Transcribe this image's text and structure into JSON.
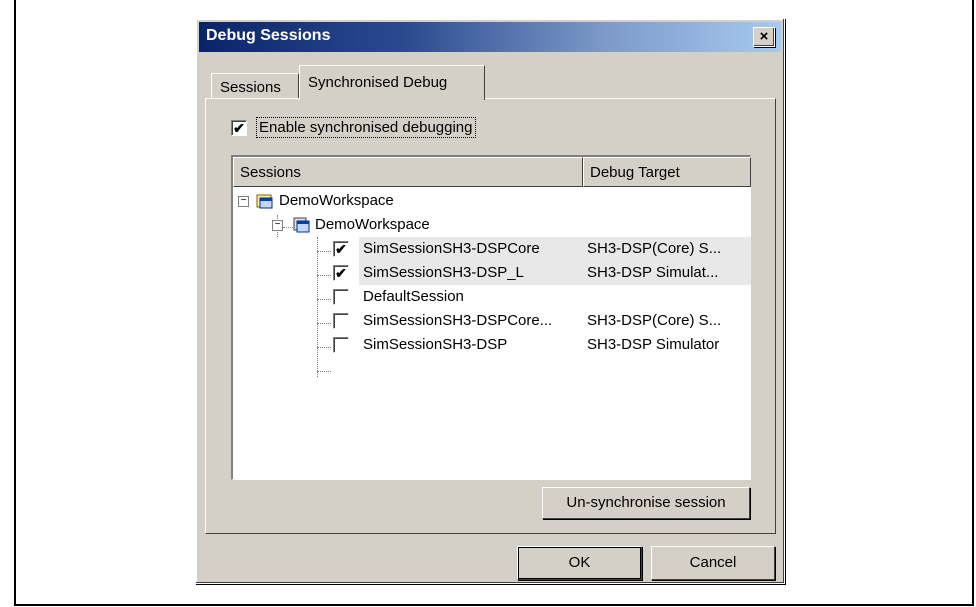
{
  "window": {
    "title": "Debug Sessions",
    "close_label": "×"
  },
  "tabs": [
    {
      "label": "Sessions",
      "active": false
    },
    {
      "label": "Synchronised Debug",
      "active": true
    }
  ],
  "enable_sync": {
    "label": "Enable synchronised debugging",
    "checked": true
  },
  "tree": {
    "columns": [
      "Sessions",
      "Debug Target"
    ],
    "workspace": "DemoWorkspace",
    "project": "DemoWorkspace",
    "sessions": [
      {
        "name": "SimSessionSH3-DSPCore",
        "target": "SH3-DSP(Core) S...",
        "checked": true,
        "highlighted": true
      },
      {
        "name": "SimSessionSH3-DSP_L",
        "target": "SH3-DSP Simulat...",
        "checked": true,
        "highlighted": true
      },
      {
        "name": "DefaultSession",
        "target": "",
        "checked": false,
        "highlighted": false
      },
      {
        "name": "SimSessionSH3-DSPCore...",
        "target": "SH3-DSP(Core) S...",
        "checked": false,
        "highlighted": false
      },
      {
        "name": "SimSessionSH3-DSP",
        "target": "SH3-DSP Simulator",
        "checked": false,
        "highlighted": false
      }
    ]
  },
  "buttons": {
    "unsync": "Un-synchronise session",
    "ok": "OK",
    "cancel": "Cancel"
  },
  "colors": {
    "titlebar": "#0a246a",
    "face": "#d4d0c8",
    "highlight_row": "#e8e8e8"
  }
}
